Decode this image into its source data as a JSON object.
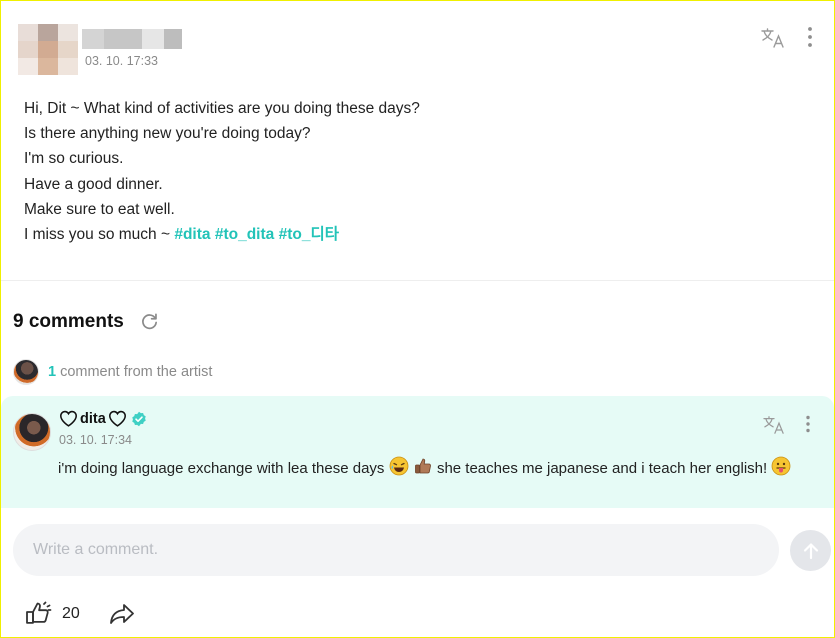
{
  "post": {
    "author_blurred": true,
    "date": "03. 10. 17:33",
    "lines": [
      "Hi, Dit ~ What kind of activities are you doing these days?",
      "Is there anything new you're doing today?",
      "I'm so curious.",
      "Have a good dinner.",
      "Make sure to eat well."
    ],
    "last_line_text": "I miss you so much ~ ",
    "hashtags": [
      "#dita",
      "#to_dita",
      "#to_디타"
    ]
  },
  "comments": {
    "title": "9 comments",
    "artist_count": "1",
    "artist_text": "comment from the artist"
  },
  "artist_comment": {
    "author": "dita",
    "verified": true,
    "date": "03. 10. 17:34",
    "text_part1": "i'm doing language exchange with lea these days",
    "text_part2": "she teaches me japanese and i teach her english!"
  },
  "composer": {
    "placeholder": "Write a comment."
  },
  "footer": {
    "like_count": "20"
  },
  "colors": {
    "accent": "#22c3b8",
    "card_background": "#e6fbf6",
    "muted_text": "#8a8a8a"
  },
  "icons": [
    "translate-icon",
    "more-icon",
    "refresh-icon",
    "verified-icon",
    "heart-outline-icon",
    "send-arrow-icon",
    "like-icon",
    "share-icon",
    "laughing-emoji",
    "thumbs-up-emoji",
    "tongue-out-emoji"
  ]
}
